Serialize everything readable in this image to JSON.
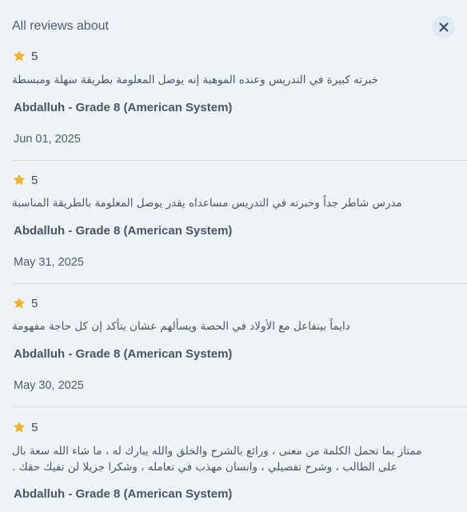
{
  "header": {
    "title": "All reviews about"
  },
  "colors": {
    "star": "#f5b324",
    "background": "#eef3f8",
    "divider": "#d6dde6"
  },
  "reviews": [
    {
      "rating": "5",
      "comment": "خبرته كبيرة في التدريس وعنده الموهبة إنه يوصل المعلومة بطريقة سهلة ومبسطة",
      "reviewer": "Abdalluh - Grade 8 (American System)",
      "date": "Jun 01, 2025"
    },
    {
      "rating": "5",
      "comment": "مدرس شاطر جداً وخبرته في التدريس مساعداه يقدر يوصل المعلومة بالطريقة المناسبة",
      "reviewer": "Abdalluh - Grade 8 (American System)",
      "date": "May 31, 2025"
    },
    {
      "rating": "5",
      "comment": "دايماً بيتفاعل مع الأولاد في الحصة ويسألهم عشان يتأكد إن كل حاجة مفهومة",
      "reviewer": "Abdalluh - Grade 8 (American System)",
      "date": "May 30, 2025"
    },
    {
      "rating": "5",
      "comment": "ممتاز بما تحمل الكلمة من معنى ، ورائع بالشرح والخلق والله يبارك له ، ما شاء الله سعة بال على الطالب ، وشرح تفصيلي ، وانسان مهذب في تعامله ، وشكرا جزيلا لن تفيك حقك .",
      "reviewer": "Abdalluh - Grade 8 (American System)",
      "date": ""
    }
  ]
}
